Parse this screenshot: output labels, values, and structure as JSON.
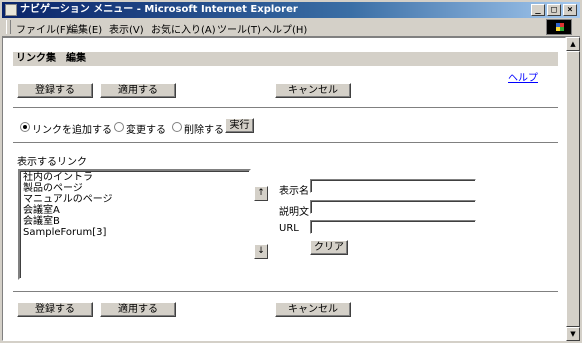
{
  "window": {
    "title": "ナビゲーション メニュー - Microsoft Internet Explorer",
    "controls": {
      "minimize": "_",
      "maximize": "□",
      "close": "×"
    }
  },
  "menubar": {
    "items": [
      {
        "label": "ファイル(F)"
      },
      {
        "label": "編集(E)"
      },
      {
        "label": "表示(V)"
      },
      {
        "label": "お気に入り(A)"
      },
      {
        "label": "ツール(T)"
      },
      {
        "label": "ヘルプ(H)"
      }
    ]
  },
  "page": {
    "header_title": "リンク集　編集",
    "help_link": "ヘルプ",
    "top_buttons": {
      "register": "登録する",
      "apply": "適用する",
      "cancel": "キャンセル"
    },
    "actions": {
      "options": [
        {
          "label": "リンクを追加する",
          "selected": true
        },
        {
          "label": "変更する",
          "selected": false
        },
        {
          "label": "削除する",
          "selected": false
        }
      ],
      "execute": "実行"
    },
    "links_section": {
      "label": "表示するリンク",
      "items": [
        "社内のイントラ",
        "製品のページ",
        "マニュアルのページ",
        "会議室A",
        "会議室B",
        "SampleForum[3]"
      ],
      "move_up": "↑",
      "move_down": "↓"
    },
    "form": {
      "display_name_label": "表示名",
      "display_name_value": "",
      "description_label": "説明文",
      "description_value": "",
      "url_label": "URL",
      "url_value": "",
      "clear_button": "クリア"
    },
    "bottom_buttons": {
      "register": "登録する",
      "apply": "適用する",
      "cancel": "キャンセル"
    }
  },
  "scrollbar": {
    "up": "▲",
    "down": "▼"
  }
}
